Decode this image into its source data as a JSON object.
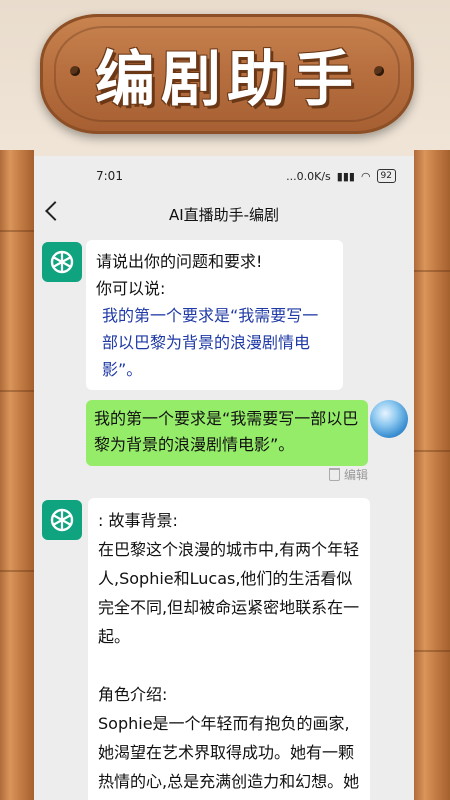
{
  "banner": {
    "title": "编剧助手"
  },
  "status_bar": {
    "time": "7:01",
    "network": "...0.0K/s",
    "battery": "92"
  },
  "nav": {
    "title": "AI直播助手-编剧"
  },
  "messages": {
    "bot1": {
      "line1": "请说出你的问题和要求!",
      "line2": "你可以说:",
      "example": "我的第一个要求是“我需要写一部以巴黎为背景的浪漫剧情电影”。"
    },
    "user1": {
      "text": "我的第一个要求是“我需要写一部以巴黎为背景的浪漫剧情电影”。",
      "edit_label": "编辑"
    },
    "bot2": {
      "heading": ": 故事背景:",
      "para1": "在巴黎这个浪漫的城市中,有两个年轻人,Sophie和Lucas,他们的生活看似完全不同,但却被命运紧密地联系在一起。",
      "heading2": "角色介绍:",
      "para2": "Sophie是一个年轻而有抱负的画家,她渴望在艺术界取得成功。她有一颗热情的心,总是充满创造力和幻想。她在巴黎的街头和咖啡馆"
    }
  },
  "colors": {
    "user_bubble": "#95ec69",
    "bot_avatar": "#10a37f",
    "link_text": "#1f3aa6"
  }
}
